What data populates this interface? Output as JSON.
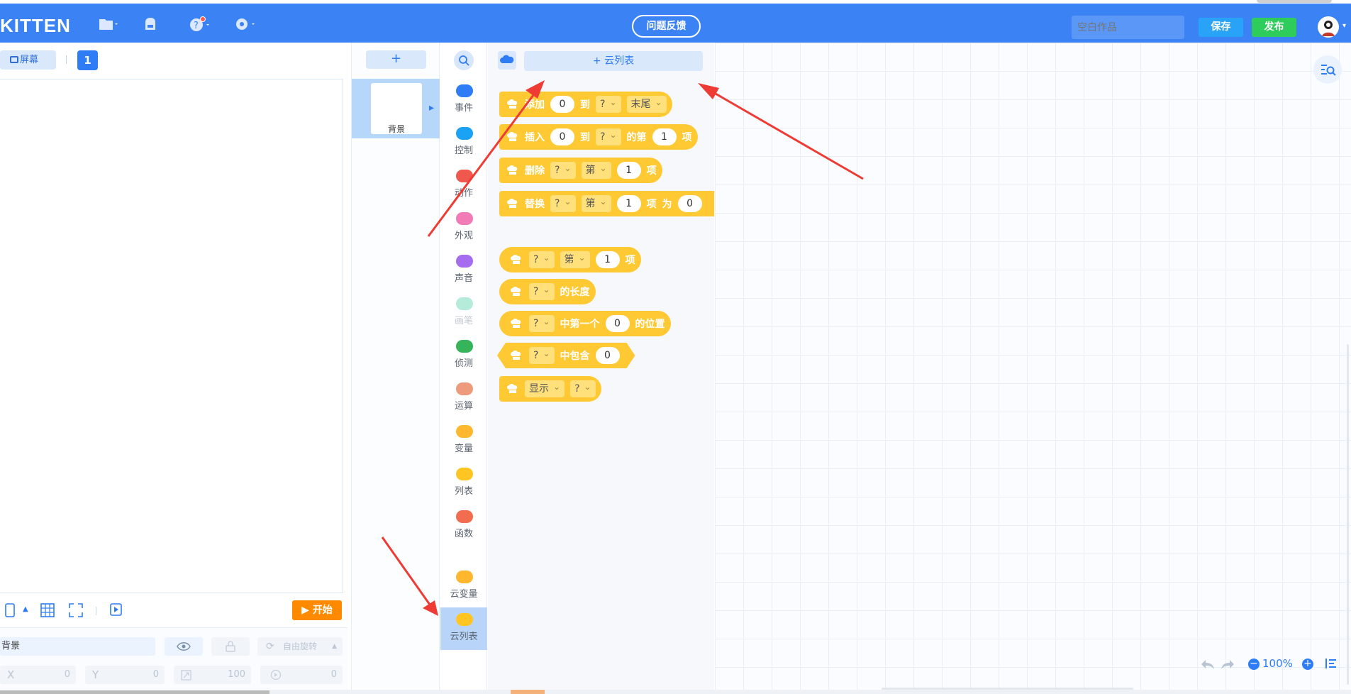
{
  "app": {
    "logo": "KITTEN",
    "feedback_label": "问题反馈",
    "title_placeholder": "空白作品",
    "save_label": "保存",
    "publish_label": "发布"
  },
  "stage": {
    "screen_label": "屏幕",
    "screen_number": "1",
    "start_label": "开始",
    "sprite_name": "背景",
    "rotate_label": "自由旋转",
    "x_label": "X",
    "x_value": "0",
    "y_label": "Y",
    "y_value": "0",
    "size_value": "100",
    "direction_value": "0"
  },
  "sprites": {
    "add_label": "+",
    "background_label": "背景"
  },
  "categories": [
    {
      "name": "事件",
      "color": "#2e7cf6"
    },
    {
      "name": "控制",
      "color": "#1aa2f5"
    },
    {
      "name": "动作",
      "color": "#f0574d"
    },
    {
      "name": "外观",
      "color": "#f27bb5"
    },
    {
      "name": "声音",
      "color": "#a66cf0"
    },
    {
      "name": "画笔",
      "color": "#b4ecd9"
    },
    {
      "name": "侦测",
      "color": "#35b45a"
    },
    {
      "name": "运算",
      "color": "#ee9a7d"
    },
    {
      "name": "变量",
      "color": "#ffb82e"
    },
    {
      "name": "列表",
      "color": "#ffc623"
    },
    {
      "name": "函数",
      "color": "#f26d4f"
    },
    {
      "name": "云变量",
      "color": "#ffb82e"
    },
    {
      "name": "云列表",
      "color": "#ffc623"
    }
  ],
  "palette": {
    "add_cloud_list_label": "+ 云列表",
    "blocks": {
      "b1": {
        "w1": "添加",
        "n1": "0",
        "w2": "到",
        "d1": "?",
        "d2": "末尾"
      },
      "b2": {
        "w1": "插入",
        "n1": "0",
        "w2": "到",
        "d1": "?",
        "w3": "的第",
        "n2": "1",
        "w4": "项"
      },
      "b3": {
        "w1": "删除",
        "d1": "?",
        "d2": "第",
        "n1": "1",
        "w2": "项"
      },
      "b4": {
        "w1": "替换",
        "d1": "?",
        "d2": "第",
        "n1": "1",
        "w2": "项",
        "w3": "为",
        "n2": "0"
      },
      "b5": {
        "d1": "?",
        "d2": "第",
        "n1": "1",
        "w1": "项"
      },
      "b6": {
        "d1": "?",
        "w1": "的长度"
      },
      "b7": {
        "d1": "?",
        "w1": "中第一个",
        "n1": "0",
        "w2": "的位置"
      },
      "b8": {
        "d1": "?",
        "w1": "中包含",
        "n1": "0"
      },
      "b9": {
        "d1": "显示",
        "d2": "?"
      }
    }
  },
  "workspace": {
    "zoom": "100%"
  },
  "colors": {
    "topbar": "#3b83f5",
    "block": "#ffc933",
    "arrow": "#ee3b34"
  }
}
